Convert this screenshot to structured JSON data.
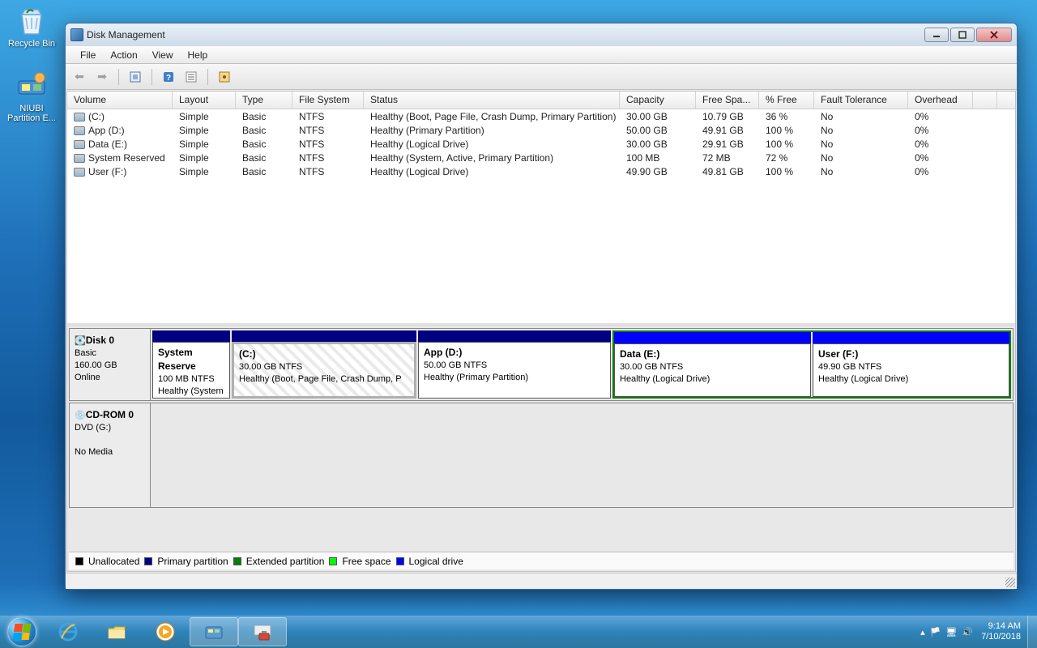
{
  "desktop": {
    "icons": [
      {
        "label": "Recycle Bin",
        "icon": "recycle-bin-icon"
      },
      {
        "label": "NIUBI Partition E...",
        "icon": "niubi-icon"
      }
    ]
  },
  "window": {
    "title": "Disk Management",
    "menu": [
      "File",
      "Action",
      "View",
      "Help"
    ],
    "columns": [
      "Volume",
      "Layout",
      "Type",
      "File System",
      "Status",
      "Capacity",
      "Free Spa...",
      "% Free",
      "Fault Tolerance",
      "Overhead",
      ""
    ],
    "volumes": [
      {
        "name": "(C:)",
        "layout": "Simple",
        "type": "Basic",
        "fs": "NTFS",
        "status": "Healthy (Boot, Page File, Crash Dump, Primary Partition)",
        "capacity": "30.00 GB",
        "free": "10.79 GB",
        "pct": "36 %",
        "ft": "No",
        "oh": "0%"
      },
      {
        "name": "App (D:)",
        "layout": "Simple",
        "type": "Basic",
        "fs": "NTFS",
        "status": "Healthy (Primary Partition)",
        "capacity": "50.00 GB",
        "free": "49.91 GB",
        "pct": "100 %",
        "ft": "No",
        "oh": "0%"
      },
      {
        "name": "Data (E:)",
        "layout": "Simple",
        "type": "Basic",
        "fs": "NTFS",
        "status": "Healthy (Logical Drive)",
        "capacity": "30.00 GB",
        "free": "29.91 GB",
        "pct": "100 %",
        "ft": "No",
        "oh": "0%"
      },
      {
        "name": "System Reserved",
        "layout": "Simple",
        "type": "Basic",
        "fs": "NTFS",
        "status": "Healthy (System, Active, Primary Partition)",
        "capacity": "100 MB",
        "free": "72 MB",
        "pct": "72 %",
        "ft": "No",
        "oh": "0%"
      },
      {
        "name": "User (F:)",
        "layout": "Simple",
        "type": "Basic",
        "fs": "NTFS",
        "status": "Healthy (Logical Drive)",
        "capacity": "49.90 GB",
        "free": "49.81 GB",
        "pct": "100 %",
        "ft": "No",
        "oh": "0%"
      }
    ],
    "disk0": {
      "label": "Disk 0",
      "type": "Basic",
      "size": "160.00 GB",
      "state": "Online",
      "system_reserved": {
        "title": "System Reserve",
        "sub": "100 MB NTFS",
        "status": "Healthy (System"
      },
      "c": {
        "title": "(C:)",
        "sub": "30.00 GB NTFS",
        "status": "Healthy (Boot, Page File, Crash Dump, P"
      },
      "app": {
        "title": "App  (D:)",
        "sub": "50.00 GB NTFS",
        "status": "Healthy (Primary Partition)"
      },
      "data": {
        "title": "Data  (E:)",
        "sub": "30.00 GB NTFS",
        "status": "Healthy (Logical Drive)"
      },
      "user": {
        "title": "User  (F:)",
        "sub": "49.90 GB NTFS",
        "status": "Healthy (Logical Drive)"
      }
    },
    "cdrom": {
      "label": "CD-ROM 0",
      "sub": "DVD (G:)",
      "state": "No Media"
    },
    "legend": {
      "unallocated": "Unallocated",
      "primary": "Primary partition",
      "extended": "Extended partition",
      "free": "Free space",
      "logical": "Logical drive"
    }
  },
  "taskbar": {
    "time": "9:14 AM",
    "date": "7/10/2018"
  }
}
